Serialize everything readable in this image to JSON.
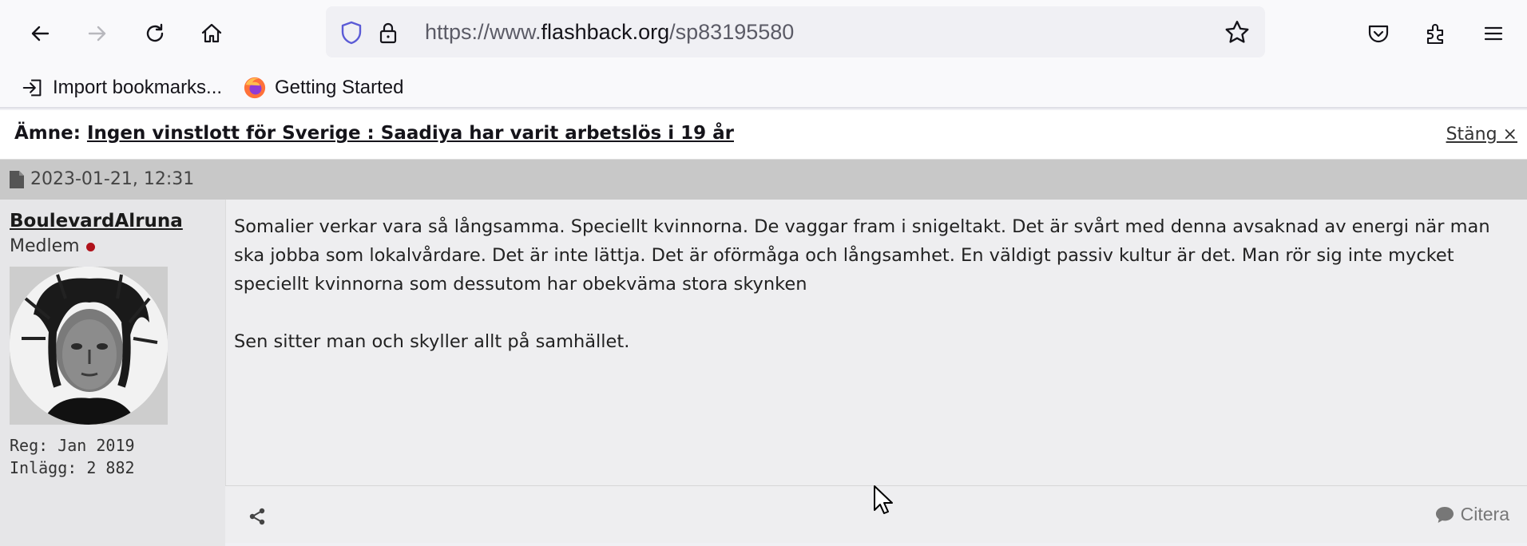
{
  "browser": {
    "url_prefix": "https://www.",
    "url_domain": "flashback.org",
    "url_path": "/sp83195580",
    "bookmarks": [
      {
        "label": "Import bookmarks..."
      },
      {
        "label": "Getting Started"
      }
    ],
    "icons": [
      "back-icon",
      "forward-icon",
      "reload-icon",
      "home-icon",
      "shield-icon",
      "lock-icon",
      "star-icon",
      "pocket-icon",
      "extensions-icon",
      "menu-icon"
    ]
  },
  "topic": {
    "prefix": "Ämne:",
    "title": "Ingen vinstlott för Sverige : Saadiya har varit arbetslös i 19 år",
    "close_label": "Stäng ×"
  },
  "post": {
    "date": "2023-01-21, 12:31",
    "author": {
      "name": "BoulevardAlruna",
      "role": "Medlem",
      "registered": "Reg: Jan 2019",
      "posts": "Inlägg: 2 882"
    },
    "lines": [
      "Somalier verkar vara så långsamma. Speciellt kvinnorna. De vaggar fram i snigeltakt. Det är svårt med denna avsaknad av energi när man",
      "ska jobba som lokalvårdare. Det är inte lättja. Det är oförmåga och långsamhet. En väldigt passiv kultur är det. Man rör sig inte mycket",
      "speciellt kvinnorna som dessutom har obekväma stora skynken",
      "Sen sitter man och skyller allt på samhället."
    ],
    "quote_label": "Citera"
  },
  "colors": {
    "online_dot": "#b0121b",
    "date_bar": "#c8c8c8",
    "user_panel": "#e6e6e8",
    "post_body": "#eeeef0"
  }
}
